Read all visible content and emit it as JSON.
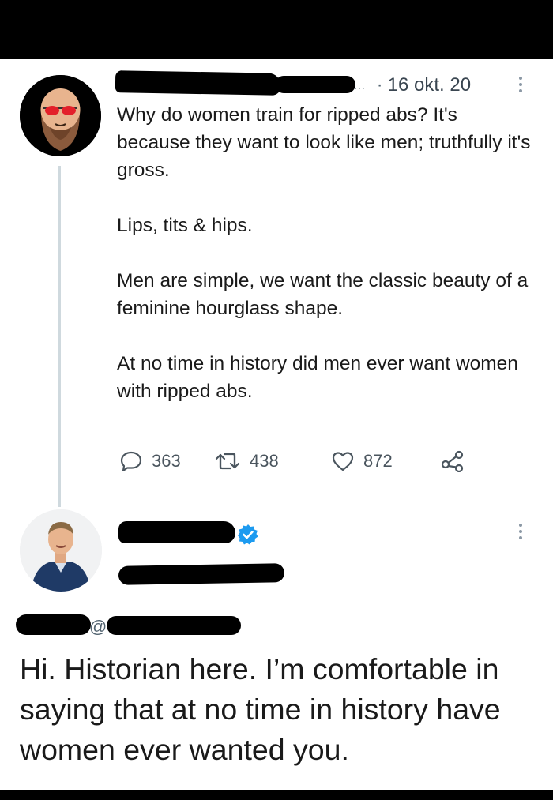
{
  "tweet1": {
    "date": "16 okt. 20",
    "name_truncation": "...",
    "separator": "·",
    "paragraphs": [
      "Why do women train for ripped abs? It's because they want to look like men; truthfully it's gross.",
      "Lips, tits & hips.",
      "Men are simple, we want the classic beauty of a feminine hourglass shape.",
      "At no time in history did men ever want women with ripped abs."
    ],
    "actions": {
      "replies": "363",
      "retweets": "438",
      "likes": "872"
    }
  },
  "tweet2": {
    "verified_color": "#1d9bf0",
    "handle_prefix": "@",
    "text": "Hi. Historian here. I’m comfortable in saying that at no time in history have women ever wanted you."
  },
  "colors": {
    "icon_gray": "#536471",
    "thread_line": "#cfd9de",
    "avatar1_glasses": "#e3202a"
  },
  "icons": [
    "reply-icon",
    "retweet-icon",
    "like-icon",
    "share-icon",
    "more-icon",
    "verified-badge-icon"
  ]
}
